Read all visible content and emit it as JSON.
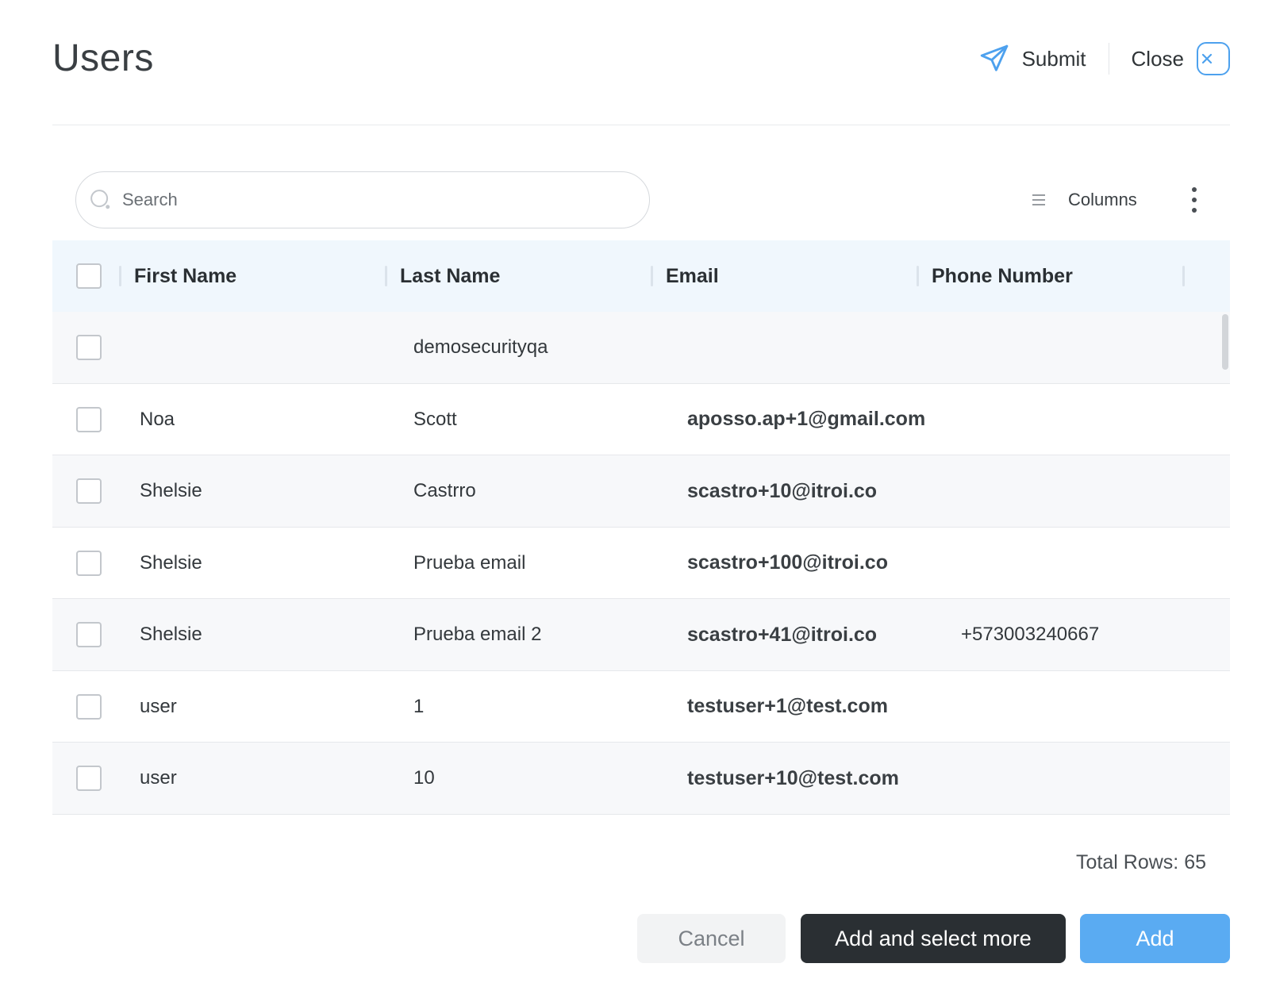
{
  "header": {
    "title": "Users",
    "submit_label": "Submit",
    "close_label": "Close"
  },
  "toolbar": {
    "search_placeholder": "Search",
    "columns_label": "Columns"
  },
  "table": {
    "columns": [
      "First Name",
      "Last Name",
      "Email",
      "Phone Number"
    ],
    "rows": [
      {
        "first": "",
        "last": "demosecurityqa",
        "email": "",
        "phone": ""
      },
      {
        "first": "Noa",
        "last": "Scott",
        "email": "aposso.ap+1@gmail.com",
        "phone": ""
      },
      {
        "first": "Shelsie",
        "last": "Castrro",
        "email": "scastro+10@itroi.co",
        "phone": ""
      },
      {
        "first": "Shelsie",
        "last": "Prueba email",
        "email": "scastro+100@itroi.co",
        "phone": ""
      },
      {
        "first": "Shelsie",
        "last": "Prueba email 2",
        "email": "scastro+41@itroi.co",
        "phone": "+573003240667"
      },
      {
        "first": "user",
        "last": "1",
        "email": "testuser+1@test.com",
        "phone": ""
      },
      {
        "first": "user",
        "last": "10",
        "email": "testuser+10@test.com",
        "phone": ""
      }
    ]
  },
  "footer": {
    "total_rows": "Total Rows: 65"
  },
  "actions": {
    "cancel_label": "Cancel",
    "add_more_label": "Add and select more",
    "add_label": "Add"
  },
  "colors": {
    "accent": "#4da1ee",
    "primary_button": "#5aabf2",
    "dark_button": "#2a2f33",
    "header_row": "#f0f7fd"
  },
  "icons": {
    "submit": "send-icon",
    "close": "close-icon",
    "search": "search-icon",
    "columns": "columns-icon",
    "more": "more-vertical-icon"
  }
}
